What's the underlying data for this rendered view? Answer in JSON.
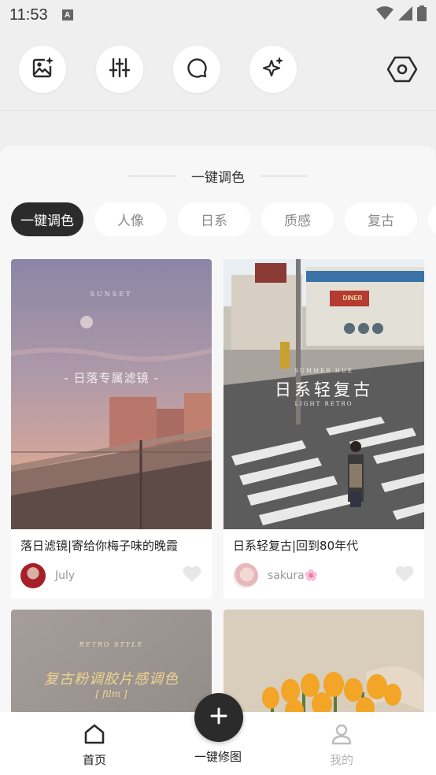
{
  "status_bar": {
    "time": "11:53",
    "notification_badge": "A"
  },
  "toolbar": {
    "tools": [
      {
        "icon": "image-sparkle-icon"
      },
      {
        "icon": "sliders-icon"
      },
      {
        "icon": "chat-bubble-icon"
      },
      {
        "icon": "sparkle-icon"
      }
    ],
    "settings_icon": "hexagon-settings-icon"
  },
  "section": {
    "title": "一键调色"
  },
  "categories": [
    "一键调色",
    "人像",
    "日系",
    "质感",
    "复古"
  ],
  "active_category": "一键调色",
  "cards": [
    {
      "title": "落日滤镜|寄给你梅子味的晚霞",
      "user": "July",
      "image_caption": "SUNSET",
      "image_heading": "- 日落专属滤镜 -"
    },
    {
      "title": "日系轻复古|回到80年代",
      "user": "sakura🌸",
      "image_caption": "SUMMER HUE",
      "image_heading": "日系轻复古",
      "image_subcaption": "LIGHT RETRO",
      "shop_sign": "DINER"
    },
    {
      "image_caption": "RETRO STYLE",
      "image_heading": "复古粉调胶片感调色",
      "image_subcaption": "[ film ]"
    },
    {}
  ],
  "bottom_nav": {
    "items": [
      {
        "label": "首页",
        "icon": "home-icon"
      },
      {
        "label": "一键修图",
        "icon": "plus-icon"
      },
      {
        "label": "我的",
        "icon": "user-icon"
      }
    ]
  },
  "colors": {
    "dark": "#2b2b2b",
    "muted": "#999999",
    "background": "#efefef"
  }
}
